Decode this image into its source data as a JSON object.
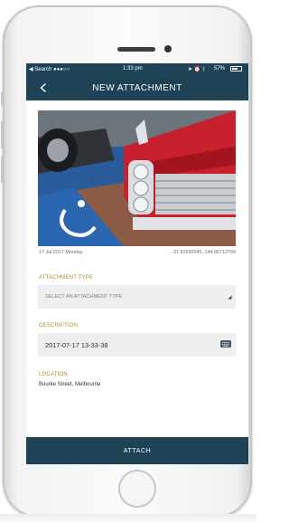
{
  "status_bar": {
    "carrier": "◀ Search ●●●○○",
    "time": "1:33 pm",
    "battery": "57%",
    "icons": [
      "back-to-app-icon",
      "wifi-icon",
      "location-icon",
      "alarm-icon",
      "bluetooth-icon",
      "battery-icon"
    ]
  },
  "header": {
    "title": "NEW ATTACHMENT",
    "back_icon": "chevron-left-icon"
  },
  "photo": {
    "date": "17 Jul 2017 Monday",
    "coordinates": "-37.81592045, 144.95712799"
  },
  "form": {
    "attachment_type": {
      "label": "ATTACHMENT TYPE",
      "value": "SELECT AN ATTACHMENT TYPE"
    },
    "description": {
      "label": "DESCRIPTION",
      "value": "2017-07-17 13-33-38",
      "icon": "keyboard-icon"
    },
    "location": {
      "label": "LOCATION",
      "value": "Bourke Street, Melbourne"
    }
  },
  "actions": {
    "attach": "ATTACH"
  },
  "colors": {
    "primary": "#1f4356",
    "label_gold": "#b5892d",
    "field_bg": "#efeff0"
  }
}
